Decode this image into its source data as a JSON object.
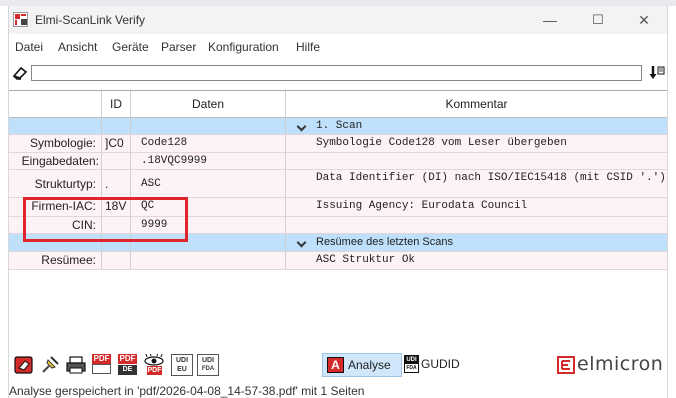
{
  "window": {
    "title": "Elmi-ScanLink Verify",
    "controls": [
      "—",
      "☐",
      "✕"
    ]
  },
  "menu": [
    "Datei",
    "Ansicht",
    "Geräte",
    "Parser",
    "Konfiguration",
    "Hilfe"
  ],
  "command_input": {
    "value": ""
  },
  "table": {
    "headers": {
      "label": "",
      "id": "ID",
      "daten": "Daten",
      "kommentar": "Kommentar"
    },
    "rows": [
      {
        "label": "",
        "id": "",
        "daten": "",
        "kommentar": "1. Scan"
      },
      {
        "label": "Symbologie:",
        "id": "]C0",
        "daten": "Code128",
        "kommentar": "Symbologie Code128 vom Leser übergeben"
      },
      {
        "label": "Eingabedaten:",
        "id": "",
        "daten": ".18VQC9999",
        "kommentar": ""
      },
      {
        "label": "Strukturtyp:",
        "id": ".",
        "daten": "ASC",
        "kommentar": "Data Identifier (DI) nach ISO/IEC15418 (mit CSID '.')"
      },
      {
        "label": "Firmen-IAC:",
        "id": "18V",
        "daten": "QC",
        "kommentar": "Issuing Agency: Eurodata Council"
      },
      {
        "label": "CIN:",
        "id": "",
        "daten": "9999",
        "kommentar": ""
      },
      {
        "label": "",
        "id": "",
        "daten": "",
        "kommentar": "Resümee des letzten Scans"
      },
      {
        "label": "Resümee:",
        "id": "",
        "daten": "",
        "kommentar": "ASC Struktur Ok"
      }
    ]
  },
  "icons": {
    "pdf1": "PDF",
    "pdf2": "PDF",
    "pdf2_sub": "DE",
    "pdf3_sub": "PDF",
    "udi_eu_top": "UDI",
    "udi_eu_bottom": "EU",
    "udi_fda_top": "UDI",
    "udi_fda_bottom": "FDA",
    "gudid_top": "UDI",
    "gudid_bottom": "FDA",
    "analyse_glyph": "A"
  },
  "bottom": {
    "analyse_label": "Analyse",
    "gudid_label": "GUDID",
    "brand": "elmicron"
  },
  "status": "Analyse gerspeichert in 'pdf/2026-04-08_14-57-38.pdf' mit 1 Seiten",
  "colors": {
    "accent_red": "#d42a2a",
    "highlight_red": "#e0242b",
    "section_blue": "#bfe0fb",
    "row_pink": "#fdf2f5",
    "analyse_active": "#cfe6fb"
  }
}
